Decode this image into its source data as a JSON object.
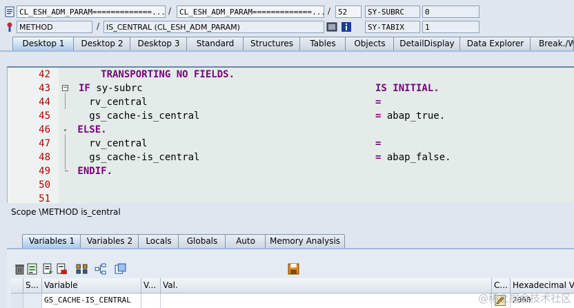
{
  "header": {
    "row1": {
      "program": "CL_ESH_ADM_PARAM=============...",
      "include": "CL_ESH_ADM_PARAM=============...",
      "line": "52",
      "var_name": "SY-SUBRC",
      "var_value": "0"
    },
    "row2": {
      "type": "METHOD",
      "event": "IS_CENTRAL (CL_ESH_ADM_PARAM)",
      "var_name": "SY-TABIX",
      "var_value": "1"
    },
    "separator": "/"
  },
  "tabs": [
    "Desktop 1",
    "Desktop 2",
    "Desktop 3",
    "Standard",
    "Structures",
    "Tables",
    "Objects",
    "DetailDisplay",
    "Data Explorer",
    "Break./W"
  ],
  "code": {
    "lines": [
      {
        "num": "42",
        "text": "     TRANSPORTING NO FIELDS.",
        "right": ""
      },
      {
        "num": "43",
        "text": " IF sy-subrc",
        "right": "IS INITIAL."
      },
      {
        "num": "44",
        "text": "   rv_central",
        "right": "="
      },
      {
        "num": "45",
        "text": "   gs_cache-is_central",
        "right": "= abap_true."
      },
      {
        "num": "46",
        "text": " ELSE.",
        "right": ""
      },
      {
        "num": "47",
        "text": "   rv_central",
        "right": "="
      },
      {
        "num": "48",
        "text": "   gs_cache-is_central",
        "right": "= abap_false."
      },
      {
        "num": "49",
        "text": " ENDIF.",
        "right": ""
      },
      {
        "num": "50",
        "text": "",
        "right": ""
      },
      {
        "num": "51",
        "text": "",
        "right": ""
      }
    ]
  },
  "scope": "Scope \\METHOD is_central",
  "bottom_tabs": [
    "Variables 1",
    "Variables 2",
    "Locals",
    "Globals",
    "Auto",
    "Memory Analysis"
  ],
  "grid": {
    "headers": [
      "S...",
      "Variable",
      "V...",
      "Val.",
      "C...",
      "Hexadecimal Valu"
    ],
    "row": {
      "variable": "GS_CACHE-IS_CENTRAL",
      "value": "",
      "hex": "2000"
    }
  },
  "watermark": "@稀土掘金技术社区"
}
